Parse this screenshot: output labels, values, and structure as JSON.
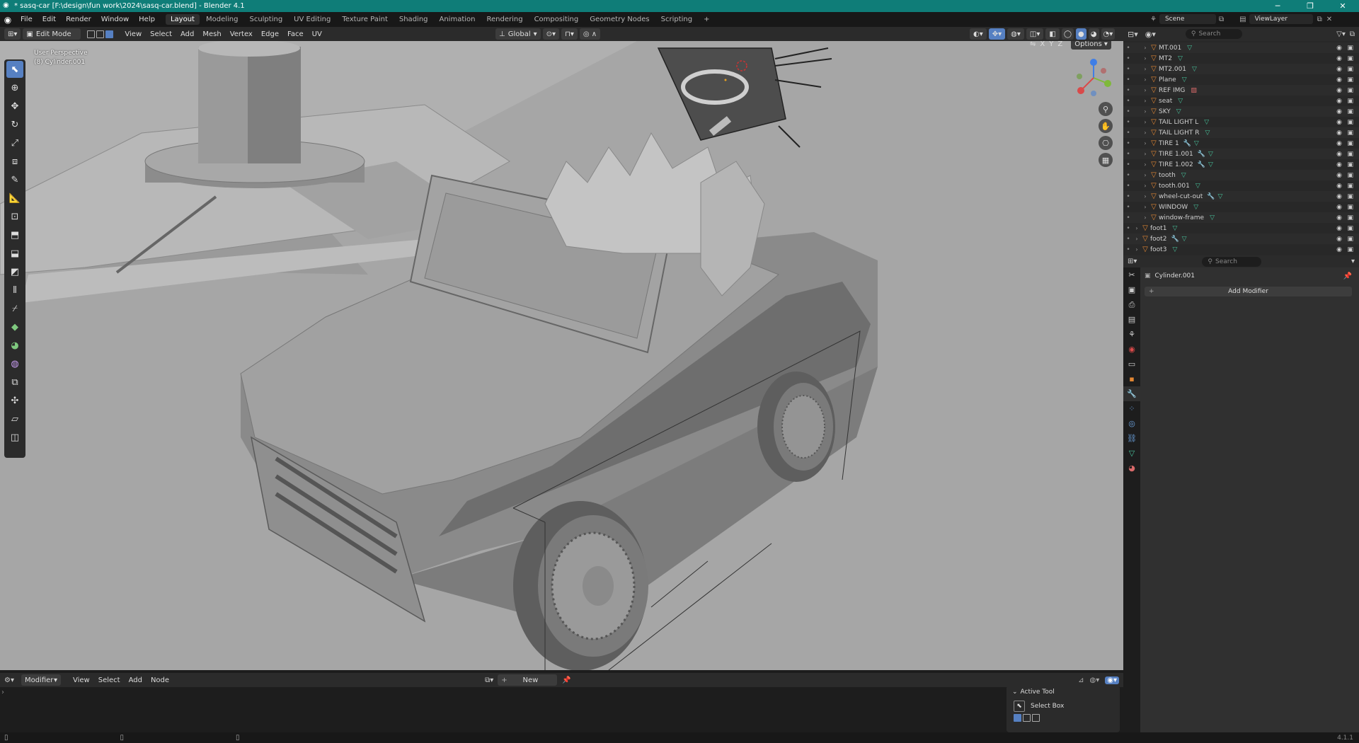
{
  "window": {
    "title": "* sasq-car [F:\\design\\fun work\\2024\\sasq-car.blend] - Blender 4.1",
    "controls": [
      "─",
      "❐",
      "✕"
    ]
  },
  "menu": [
    "File",
    "Edit",
    "Render",
    "Window",
    "Help"
  ],
  "workspaces": [
    "Layout",
    "Modeling",
    "Sculpting",
    "UV Editing",
    "Texture Paint",
    "Shading",
    "Animation",
    "Rendering",
    "Compositing",
    "Geometry Nodes",
    "Scripting",
    "+"
  ],
  "scene": {
    "name": "Scene",
    "view_layer": "ViewLayer"
  },
  "viewport": {
    "mode": "Edit Mode",
    "menus": [
      "View",
      "Select",
      "Add",
      "Mesh",
      "Vertex",
      "Edge",
      "Face",
      "UV"
    ],
    "orientation": "Global",
    "axes": [
      "X",
      "Y",
      "Z"
    ],
    "options_label": "Options",
    "perspective": "User Perspective",
    "object_info": "(8) Cylinder.001"
  },
  "outliner": {
    "search_placeholder": "Search",
    "items": [
      {
        "name": "MT.001",
        "wrench": false
      },
      {
        "name": "MT2",
        "wrench": false
      },
      {
        "name": "MT2.001",
        "wrench": false
      },
      {
        "name": "Plane",
        "wrench": false
      },
      {
        "name": "REF IMG",
        "image": true
      },
      {
        "name": "seat",
        "wrench": false
      },
      {
        "name": "SKY",
        "wrench": false
      },
      {
        "name": "TAIL LIGHT L",
        "wrench": false
      },
      {
        "name": "TAIL LIGHT R",
        "wrench": false
      },
      {
        "name": "TIRE 1",
        "wrench": true
      },
      {
        "name": "TIRE 1.001",
        "wrench": true
      },
      {
        "name": "TIRE 1.002",
        "wrench": true
      },
      {
        "name": "tooth",
        "wrench": false
      },
      {
        "name": "tooth.001",
        "wrench": false
      },
      {
        "name": "wheel-cut-out",
        "wrench": true
      },
      {
        "name": "WINDOW",
        "wrench": false
      },
      {
        "name": "window-frame",
        "wrench": false
      },
      {
        "name": "foot1",
        "wrench": false,
        "top": true
      },
      {
        "name": "foot2",
        "wrench": true,
        "top": true
      },
      {
        "name": "foot3",
        "wrench": false,
        "top": true
      }
    ]
  },
  "properties": {
    "search_placeholder": "Search",
    "object": "Cylinder.001",
    "add_modifier": "Add Modifier"
  },
  "node_editor": {
    "editor": "Modifier",
    "menus": [
      "View",
      "Select",
      "Add",
      "Node"
    ],
    "new_label": "New"
  },
  "active_tool": {
    "header": "Active Tool",
    "tool": "Select Box"
  },
  "status": {
    "version": "4.1.1"
  }
}
